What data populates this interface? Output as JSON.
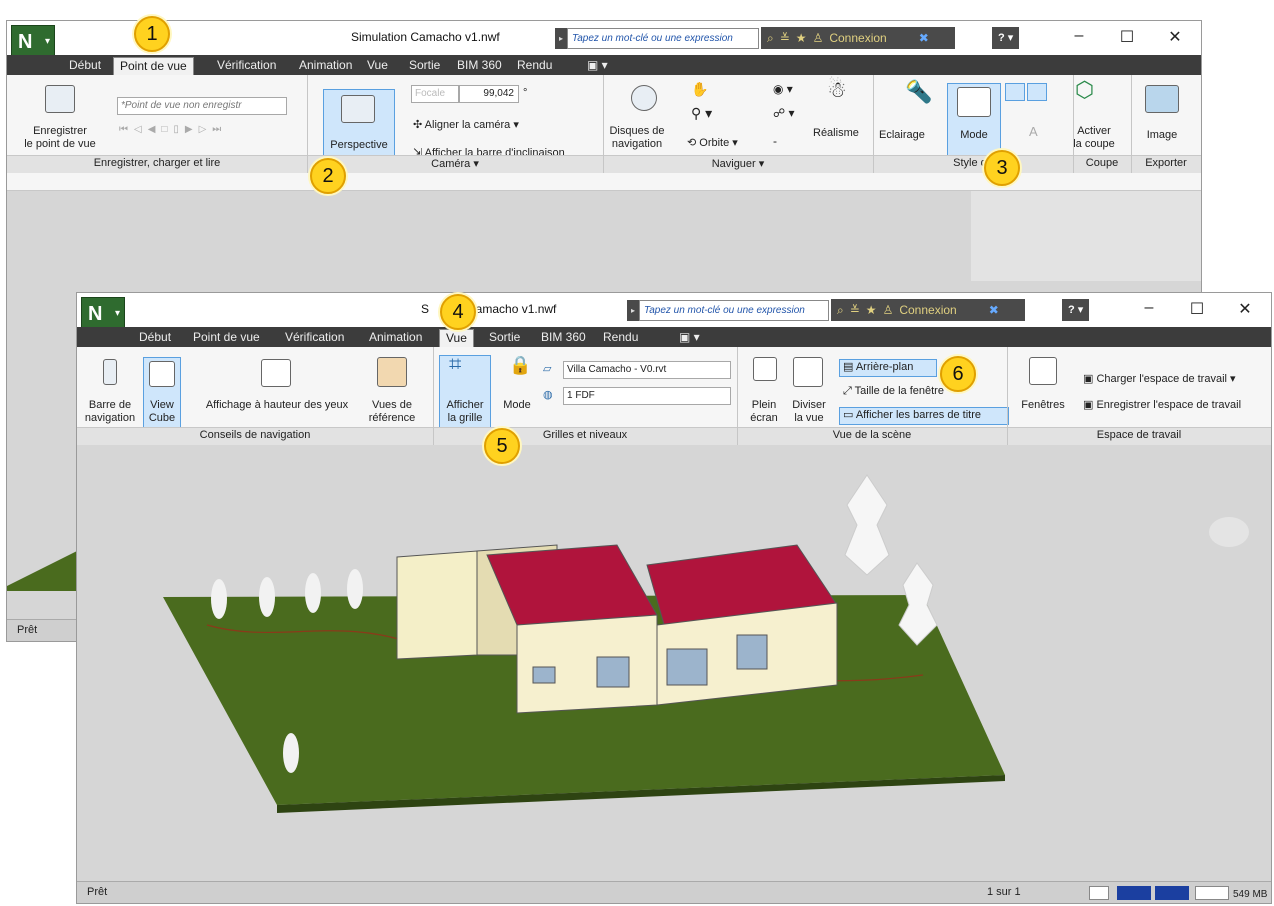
{
  "back": {
    "title": "Simulation Camacho v1.nwf",
    "search_placeholder": "Tapez un mot-clé ou une expression",
    "connexion": "Connexion",
    "tabs": [
      "Début",
      "Point de vue",
      "Vérification",
      "Animation",
      "Vue",
      "Sortie",
      "BIM 360",
      "Rendu"
    ],
    "active_tab": "Point de vue",
    "ribbon": {
      "save_viewpoint": "Enregistrer\nle point de vue",
      "viewpoint_select": "*Point de vue non enregistr",
      "focale_label": "Focale",
      "focale_value": "99,042",
      "degree": "°",
      "perspective": "Perspective",
      "align_camera": "Aligner la caméra",
      "show_tilt_bar": "Afficher la barre d'inclinaison",
      "nav_disks": "Disques de\nnavigation",
      "orbit": "Orbite",
      "realism": "Réalisme",
      "lighting": "Eclairage",
      "mode": "Mode",
      "activate_section": "Activer\nla coupe",
      "image": "Image"
    },
    "panels": {
      "save_load": "Enregistrer, charger et lire",
      "camera": "Caméra",
      "navigate": "Naviguer",
      "style": "Style de",
      "section": "Coupe",
      "export": "Exporter"
    },
    "status": "Prêt"
  },
  "front": {
    "title": "Simulation Camacho v1.nwf",
    "title_visible": "S",
    "title_rest": "Camacho v1.nwf",
    "search_placeholder": "Tapez un mot-clé ou une expression",
    "connexion": "Connexion",
    "tabs": [
      "Début",
      "Point de vue",
      "Vérification",
      "Animation",
      "Vue",
      "Sortie",
      "BIM 360",
      "Rendu"
    ],
    "active_tab": "Vue",
    "ribbon": {
      "nav_bar": "Barre de\nnavigation",
      "view_cube": "View\nCube",
      "eye_height": "Affichage à hauteur des yeux",
      "reference_views": "Vues de\nréférence",
      "show_grid": "Afficher\nla grille",
      "mode": "Mode",
      "model_select": "Villa Camacho - V0.rvt",
      "level_select": "1 FDF",
      "full_screen": "Plein\nécran",
      "split_view": "Diviser\nla vue",
      "background": "Arrière-plan",
      "window_size": "Taille de la fenêtre",
      "show_title_bars": "Afficher les barres de titre",
      "windows": "Fenêtres",
      "load_workspace": "Charger l'espace de travail",
      "save_workspace": "Enregistrer l'espace de travail"
    },
    "panels": {
      "nav_aids": "Conseils de navigation",
      "grids_levels": "Grilles et niveaux",
      "scene_view": "Vue de la scène",
      "workspace": "Espace de travail"
    },
    "status": "Prêt",
    "page": "1 sur 1",
    "memory": "549 MB"
  },
  "callouts": [
    "1",
    "2",
    "3",
    "4",
    "5",
    "6"
  ],
  "colors": {
    "tab_bar": "#3c3c3c",
    "roof": "#b0143c",
    "ground": "#4a6b1e",
    "highlight": "#cfe6fb",
    "badge": "#ffd21f"
  }
}
